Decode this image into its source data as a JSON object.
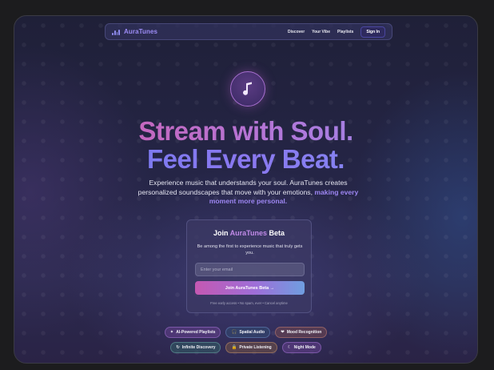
{
  "nav": {
    "brand": "AuraTunes",
    "links": [
      "Discover",
      "Your Vibe",
      "Playlists"
    ],
    "signin": "Sign In"
  },
  "hero": {
    "line1": "Stream with Soul.",
    "line2": "Feel Every Beat.",
    "subtitle_plain": "Experience music that understands your soul. AuraTunes creates personalized soundscapes that move with your emotions,",
    "subtitle_highlight": "making every moment more personal."
  },
  "signup": {
    "title_join": "Join",
    "title_brand": "AuraTunes",
    "title_beta": "Beta",
    "description": "Be among the first to experience music that truly gets you.",
    "email_placeholder": "Enter your email",
    "button": "Join AuraTunes Beta →",
    "fineprint": "Free early access • No spam, ever • Cancel anytime"
  },
  "features": [
    {
      "icon": "✦",
      "label": "AI-Powered Playlists"
    },
    {
      "icon": "🎧",
      "label": "Spatial Audio"
    },
    {
      "icon": "❤",
      "label": "Mood Recognition"
    },
    {
      "icon": "↻",
      "label": "Infinite Discovery"
    },
    {
      "icon": "🔒",
      "label": "Private Listening"
    },
    {
      "icon": "☾",
      "label": "Night Mode"
    }
  ],
  "colors": {
    "accent_purple": "#9d86f2",
    "accent_pink": "#d45aa6",
    "accent_blue": "#6e7cf0"
  }
}
